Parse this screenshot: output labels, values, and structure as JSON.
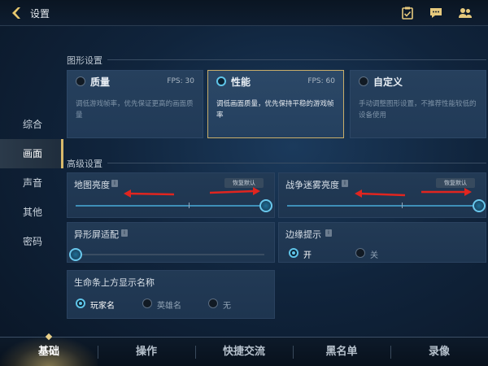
{
  "header": {
    "title": "设置",
    "icons": [
      "back-icon",
      "clipboard-check-icon",
      "chat-icon",
      "friends-icon"
    ]
  },
  "sidebar": {
    "items": [
      {
        "label": "综合",
        "active": false
      },
      {
        "label": "画面",
        "active": true
      },
      {
        "label": "声音",
        "active": false
      },
      {
        "label": "其他",
        "active": false
      },
      {
        "label": "密码",
        "active": false
      }
    ]
  },
  "graphics": {
    "section_title": "图形设置",
    "cards": [
      {
        "name": "质量",
        "fps": "FPS: 30",
        "desc": "调低游戏帧率，优先保证更高的画面质量",
        "selected": false
      },
      {
        "name": "性能",
        "fps": "FPS: 60",
        "desc": "调低画面质量，优先保持平稳的游戏帧率",
        "selected": true
      },
      {
        "name": "自定义",
        "fps": "",
        "desc": "手动调整图形设置，不推荐性能较低的设备使用",
        "selected": false
      }
    ]
  },
  "advanced": {
    "section_title": "高级设置",
    "map_brightness": {
      "label": "地图亮度",
      "reset": "恢复默认",
      "value": 1.0
    },
    "fog_brightness": {
      "label": "战争迷雾亮度",
      "reset": "恢复默认",
      "value": 1.0
    },
    "notch_adapt": {
      "label": "异形屏适配",
      "value": 0.0
    },
    "edge_hint": {
      "label": "边缘提示",
      "options": [
        "开",
        "关"
      ],
      "selected": "开"
    },
    "healthbar_name": {
      "label": "生命条上方显示名称",
      "options": [
        "玩家名",
        "英雄名",
        "无"
      ],
      "selected": "玩家名"
    }
  },
  "bottom_tabs": [
    {
      "label": "基础",
      "active": true
    },
    {
      "label": "操作",
      "active": false
    },
    {
      "label": "快捷交流",
      "active": false
    },
    {
      "label": "黑名单",
      "active": false
    },
    {
      "label": "录像",
      "active": false
    }
  ],
  "colors": {
    "accent_gold": "#c9ae6a",
    "accent_cyan": "#69c7ec",
    "annotation_red": "#e0251f"
  }
}
